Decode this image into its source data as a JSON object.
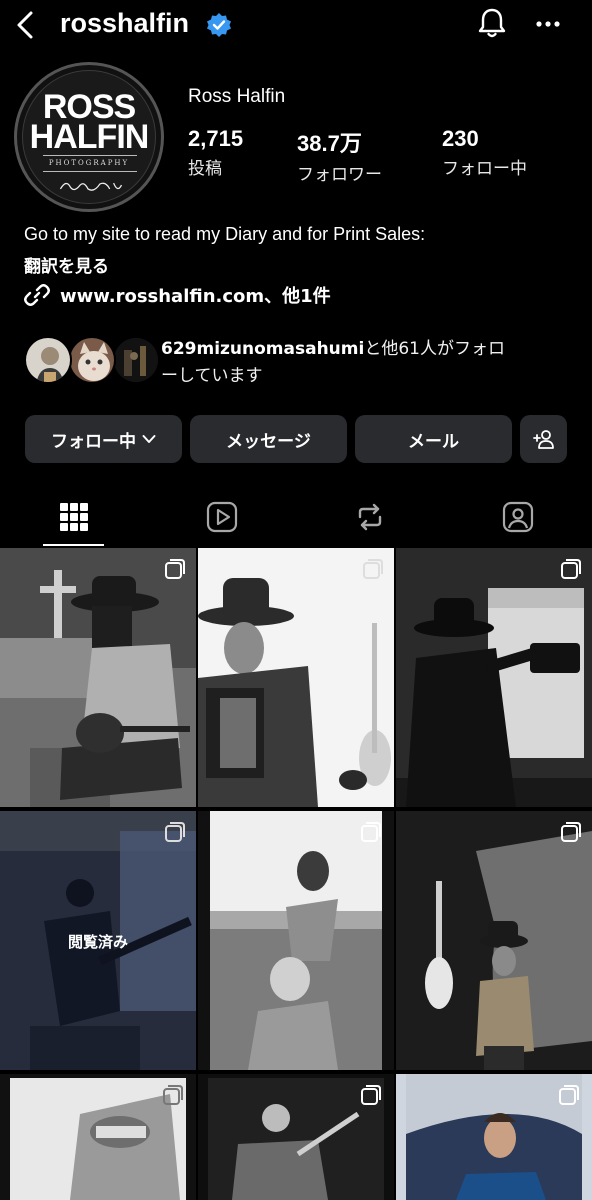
{
  "header": {
    "username": "rosshalfin",
    "icons": [
      "back-chevron-icon",
      "verified-badge-icon",
      "bell-icon",
      "more-dots-icon"
    ]
  },
  "profile": {
    "display_name": "Ross Halfin",
    "avatar_logo": {
      "line1": "ROSS",
      "line2": "HALFIN",
      "line3": "PHOTOGRAPHY"
    },
    "stats": [
      {
        "value": "2,715",
        "label": "投稿"
      },
      {
        "value": "38.7万",
        "label": "フォロワー"
      },
      {
        "value": "230",
        "label": "フォロー中"
      }
    ],
    "bio": "Go to my site to read my Diary and for Print Sales:",
    "translate_label": "翻訳を見る",
    "link": "www.rosshalfin.com、他1件"
  },
  "mutual": {
    "name": "629mizunomasahumi",
    "suffix": "と他61人がフォロ",
    "line2": "ーしています"
  },
  "actions": {
    "following": "フォロー中",
    "message": "メッセージ",
    "email": "メール"
  },
  "tabs": [
    "grid-icon",
    "reels-icon",
    "reposts-icon",
    "tagged-icon"
  ],
  "grid": {
    "seen_label": "閲覧済み"
  }
}
